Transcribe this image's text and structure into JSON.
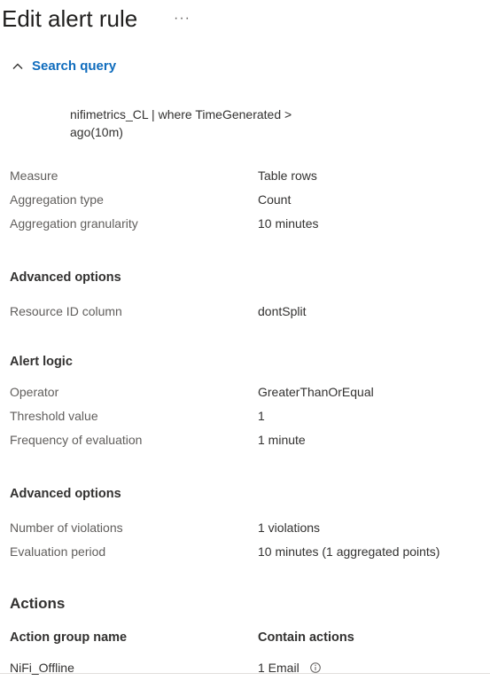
{
  "header": {
    "title": "Edit alert rule",
    "more_label": "···"
  },
  "query_section": {
    "toggle_label": "Search query",
    "query": "nifimetrics_CL | where TimeGenerated > ago(10m)"
  },
  "measure_rows": [
    {
      "label": "Measure",
      "value": "Table rows"
    },
    {
      "label": "Aggregation type",
      "value": "Count"
    },
    {
      "label": "Aggregation granularity",
      "value": "10 minutes"
    }
  ],
  "advanced_options_1": {
    "heading": "Advanced options",
    "rows": [
      {
        "label": "Resource ID column",
        "value": "dontSplit"
      }
    ]
  },
  "alert_logic": {
    "heading": "Alert logic",
    "rows": [
      {
        "label": "Operator",
        "value": "GreaterThanOrEqual"
      },
      {
        "label": "Threshold value",
        "value": "1"
      },
      {
        "label": "Frequency of evaluation",
        "value": "1 minute"
      }
    ]
  },
  "advanced_options_2": {
    "heading": "Advanced options",
    "rows": [
      {
        "label": "Number of violations",
        "value": "1 violations"
      },
      {
        "label": "Evaluation period",
        "value": "10 minutes (1 aggregated points)"
      }
    ]
  },
  "actions": {
    "title": "Actions",
    "col_group_name": "Action group name",
    "col_contain_actions": "Contain actions",
    "rows": [
      {
        "group_name": "NiFi_Offline",
        "contain_actions": "1 Email",
        "info_icon": "info-icon"
      }
    ]
  },
  "colors": {
    "accent": "#0f6cbd",
    "label": "#605e5c",
    "text": "#323130"
  }
}
